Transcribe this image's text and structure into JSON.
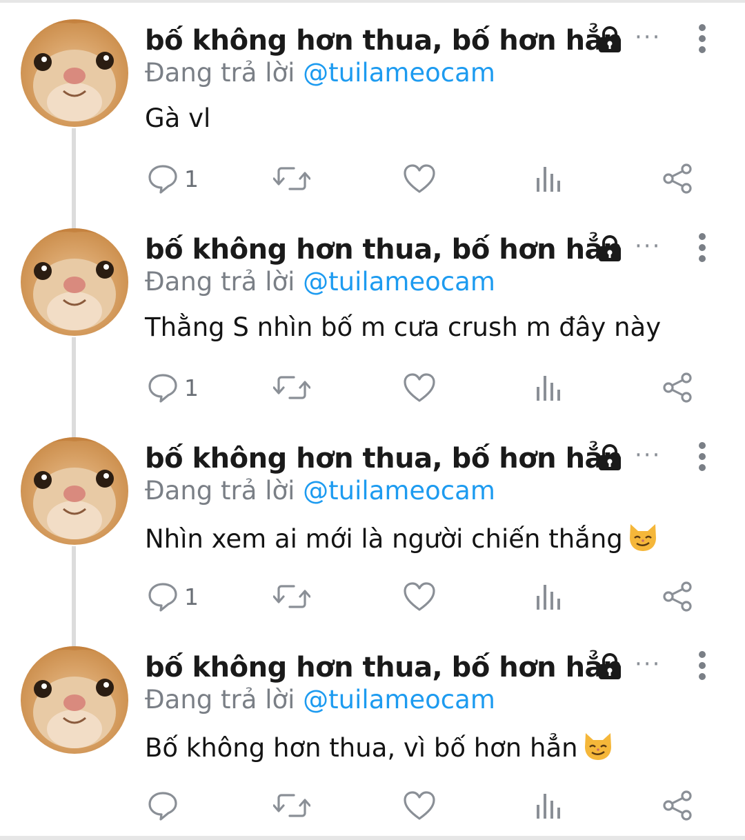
{
  "user": {
    "display_name": "bố không hơn thua, bố hơn hẳn",
    "reply_prefix": "Đang trả lời",
    "reply_handle": "@tuilameocam",
    "protected_icon": "lock-icon",
    "more_icon": "more-horizontal-icon",
    "menu_icon": "more-vertical-icon"
  },
  "tweets": [
    {
      "text": "Gà vl",
      "reply_count": "1",
      "emoji": ""
    },
    {
      "text": "Thằng S nhìn bố m cưa crush m đây này",
      "reply_count": "1",
      "emoji": ""
    },
    {
      "text": "Nhìn xem ai mới là người chiến thắng",
      "reply_count": "1",
      "emoji": "smirking-cat-icon"
    },
    {
      "text": "Bố không hơn thua, vì bố hơn hẳn",
      "reply_count": "",
      "emoji": "smirking-cat-icon"
    }
  ],
  "action_icons": [
    "reply-icon",
    "retweet-icon",
    "like-icon",
    "views-icon",
    "share-icon"
  ],
  "colors": {
    "handle": "#1d9bf0",
    "muted": "#7a7f86",
    "text": "#141414",
    "icon": "#8a8f96",
    "thread_line": "#dcdcdc"
  }
}
